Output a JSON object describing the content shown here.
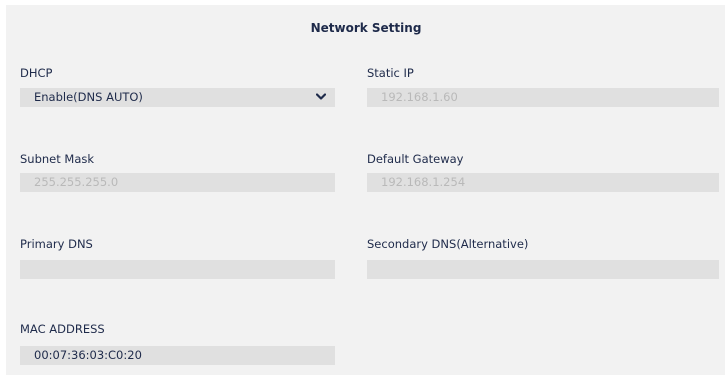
{
  "form": {
    "title": "Network Setting",
    "dhcp": {
      "label": "DHCP",
      "value": "Enable(DNS AUTO)"
    },
    "static_ip": {
      "label": "Static IP",
      "value": "192.168.1.60"
    },
    "subnet_mask": {
      "label": "Subnet Mask",
      "value": "255.255.255.0"
    },
    "default_gateway": {
      "label": "Default Gateway",
      "value": "192.168.1.254"
    },
    "primary_dns": {
      "label": "Primary DNS",
      "value": ""
    },
    "secondary_dns": {
      "label": "Secondary DNS(Alternative)",
      "value": ""
    },
    "mac_address": {
      "label": "MAC ADDRESS",
      "value": "00:07:36:03:C0:20"
    }
  },
  "icons": {
    "dropdown": "chevron-down-icon"
  },
  "colors": {
    "panel_background": "#f2f2f2",
    "field_background": "#e0e0e0",
    "label_text": "#1e2a4a",
    "disabled_text": "#b9b9b9"
  }
}
